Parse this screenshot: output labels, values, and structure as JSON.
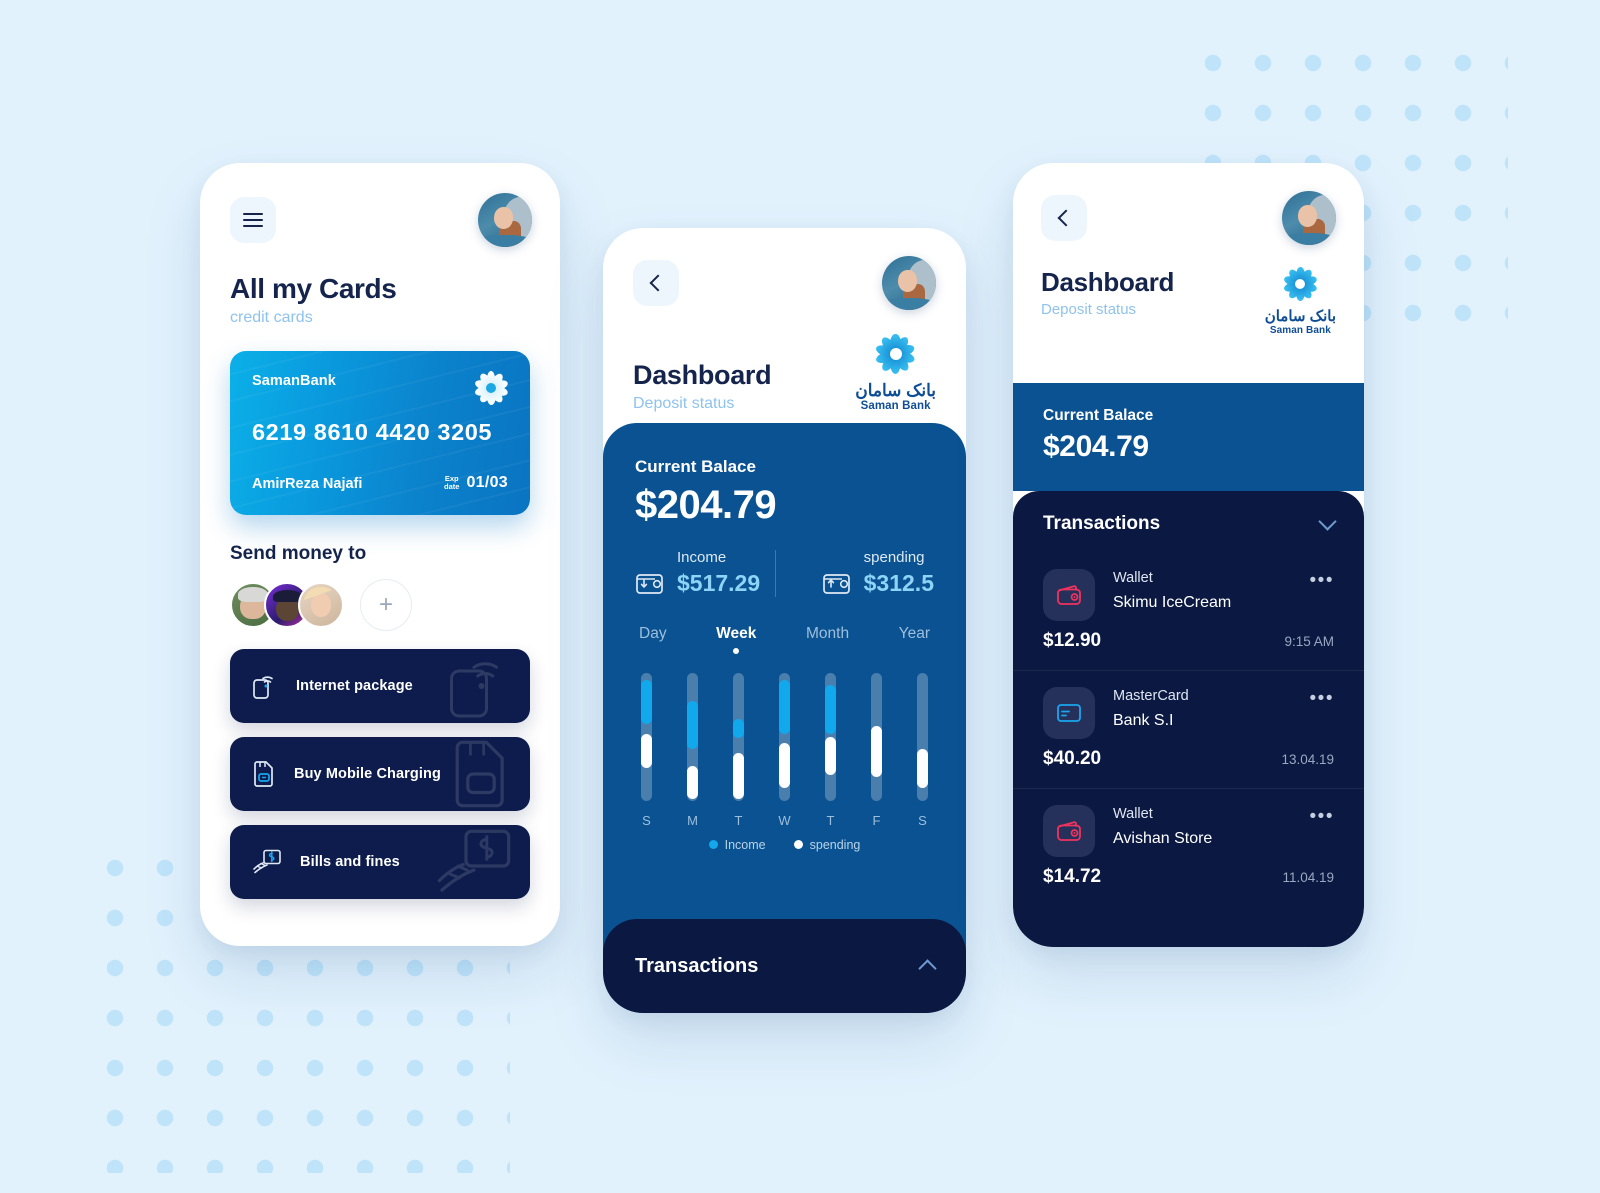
{
  "theme": {
    "page_bg": "#e2f2fd",
    "dot_color": "#bfe4fa",
    "navy": "#0b1942",
    "blue_panel": "#0a5291",
    "card_gradient_from": "#0bb0e8",
    "card_gradient_to": "#0a74c2",
    "accent_cyan": "#11a8ec",
    "muted_blue": "#8ec3ee",
    "wallet_red": "#f0325e"
  },
  "phone_cards": {
    "menu_icon": "hamburger-menu-icon",
    "back_icon": "chevron-left-icon",
    "avatar": "user-avatar",
    "title": "All my Cards",
    "subtitle": "credit cards",
    "card": {
      "bank": "SamanBank",
      "logo": "saman-flower-logo",
      "number": "6219  8610  4420  3205",
      "holder": "AmirReza Najafi",
      "exp_label_line1": "Exp",
      "exp_label_line2": "date",
      "exp_value": "01/03"
    },
    "send_money_title": "Send money to",
    "contacts": [
      {
        "name": "contact-1"
      },
      {
        "name": "contact-2"
      },
      {
        "name": "contact-3"
      }
    ],
    "add_contact_label": "+",
    "actions": [
      {
        "label": "Internet package",
        "icon": "phone-wifi-icon"
      },
      {
        "label": "Buy Mobile Charging",
        "icon": "sim-card-icon"
      },
      {
        "label": "Bills and fines",
        "icon": "bill-payment-icon"
      }
    ]
  },
  "phone_dashboard": {
    "back_icon": "chevron-left-icon",
    "avatar": "user-avatar",
    "title": "Dashboard",
    "subtitle": "Deposit status",
    "bank_logo": {
      "mark": "saman-flower-logo",
      "fa_name": "بانک سامان",
      "en_name": "Saman Bank"
    },
    "balance_label": "Current Balace",
    "balance_value": "$204.79",
    "income": {
      "icon": "wallet-in-icon",
      "label": "Income",
      "value": "$517.29"
    },
    "spending": {
      "icon": "wallet-out-icon",
      "label": "spending",
      "value": "$312.5"
    },
    "ranges": [
      {
        "label": "Day",
        "active": false
      },
      {
        "label": "Week",
        "active": true
      },
      {
        "label": "Month",
        "active": false
      },
      {
        "label": "Year",
        "active": false
      }
    ],
    "legend": [
      {
        "label": "Income",
        "color": "#11a8ec"
      },
      {
        "label": "spending",
        "color": "#ffffff"
      }
    ],
    "transactions_label": "Transactions",
    "transactions_toggle_icon": "chevron-up-icon"
  },
  "chart_data": {
    "type": "bar",
    "title": "Weekly income vs spending",
    "xlabel": "",
    "ylabel": "",
    "categories": [
      "S",
      "M",
      "T",
      "W",
      "T",
      "F",
      "S"
    ],
    "grid": false,
    "legend_position": "bottom",
    "axis_range_percent": [
      0,
      100
    ],
    "series": [
      {
        "name": "Income",
        "color": "#11a8ec",
        "segments": [
          {
            "top_pct": 6,
            "height_pct": 34
          },
          {
            "top_pct": 22,
            "height_pct": 38
          },
          {
            "top_pct": 36,
            "height_pct": 15
          },
          {
            "top_pct": 6,
            "height_pct": 42
          },
          {
            "top_pct": 10,
            "height_pct": 38
          },
          {
            "top_pct": 0,
            "height_pct": 0
          },
          {
            "top_pct": 0,
            "height_pct": 0
          }
        ]
      },
      {
        "name": "spending",
        "color": "#ffffff",
        "segments": [
          {
            "top_pct": 48,
            "height_pct": 27
          },
          {
            "top_pct": 73,
            "height_pct": 26
          },
          {
            "top_pct": 63,
            "height_pct": 36
          },
          {
            "top_pct": 55,
            "height_pct": 35
          },
          {
            "top_pct": 50,
            "height_pct": 30
          },
          {
            "top_pct": 42,
            "height_pct": 40
          },
          {
            "top_pct": 60,
            "height_pct": 30
          }
        ]
      }
    ]
  },
  "phone_transactions": {
    "back_icon": "chevron-left-icon",
    "avatar": "user-avatar",
    "title": "Dashboard",
    "subtitle": "Deposit status",
    "bank_logo": {
      "mark": "saman-flower-logo",
      "fa_name": "بانک سامان",
      "en_name": "Saman Bank"
    },
    "balance_label": "Current Balace",
    "balance_value": "$204.79",
    "list_title": "Transactions",
    "list_toggle_icon": "chevron-down-icon",
    "items": [
      {
        "icon": "wallet-icon",
        "icon_color": "#f0325e",
        "type": "Wallet",
        "merchant": "Skimu IceCream",
        "amount": "$12.90",
        "time": "9:15 AM",
        "menu": "•••"
      },
      {
        "icon": "credit-card-icon",
        "icon_color": "#19a6ef",
        "type": "MasterCard",
        "merchant": "Bank S.I",
        "amount": "$40.20",
        "time": "13.04.19",
        "menu": "•••"
      },
      {
        "icon": "wallet-icon",
        "icon_color": "#f0325e",
        "type": "Wallet",
        "merchant": "Avishan Store",
        "amount": "$14.72",
        "time": "11.04.19",
        "menu": "•••"
      }
    ]
  }
}
